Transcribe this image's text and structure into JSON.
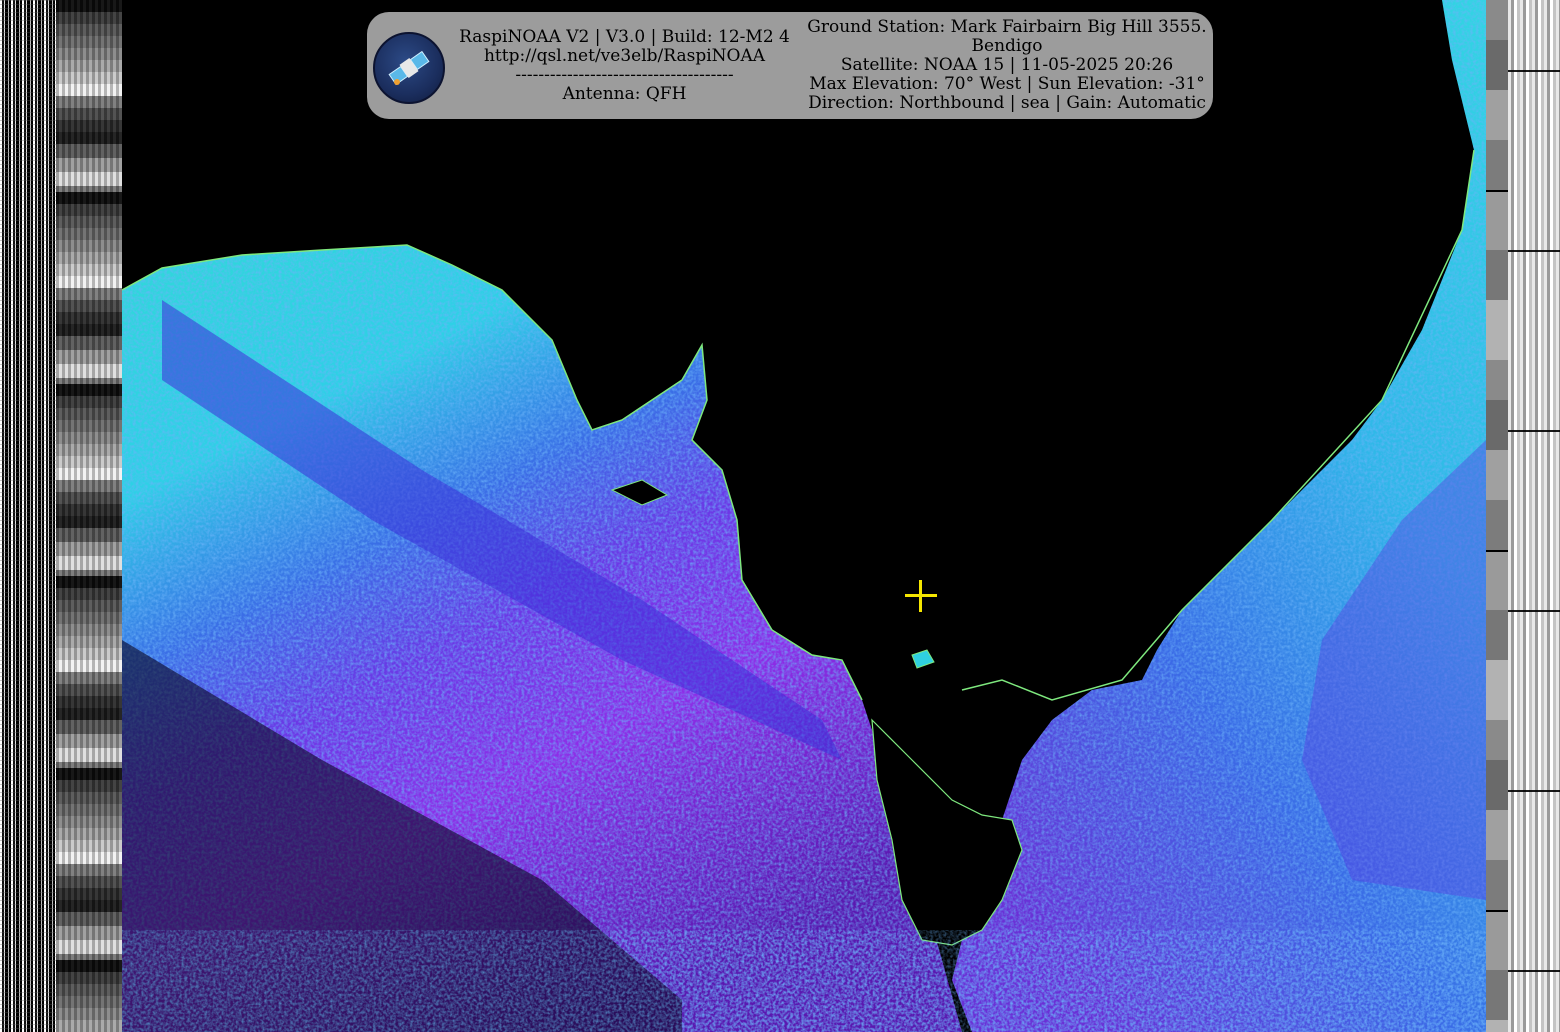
{
  "overlay": {
    "header": "RaspiNOAA V2 | V3.0 | Build: 12-M2 4",
    "url": "http://qsl.net/ve3elb/RaspiNOAA",
    "separator": "--------------------------------------",
    "antenna": "Antenna: QFH",
    "ground_station_line1": "Ground Station: Mark Fairbairn Big Hill 3555.",
    "ground_station_line2": "Bendigo",
    "satellite": "Satellite: NOAA 15 | 11-05-2025 20:26",
    "elevation": "Max Elevation: 70° West | Sun Elevation: -31°",
    "direction": "Direction: Northbound | sea | Gain: Automatic",
    "logo_icon": "satellite-icon"
  },
  "colors": {
    "ocean_light": "#29d6e0",
    "ocean_mid": "#2f7fe3",
    "ocean_deep": "#8a2be8",
    "land": "#000000",
    "crosshair": "#f5e600",
    "overlay_bg": "#bebebe"
  }
}
